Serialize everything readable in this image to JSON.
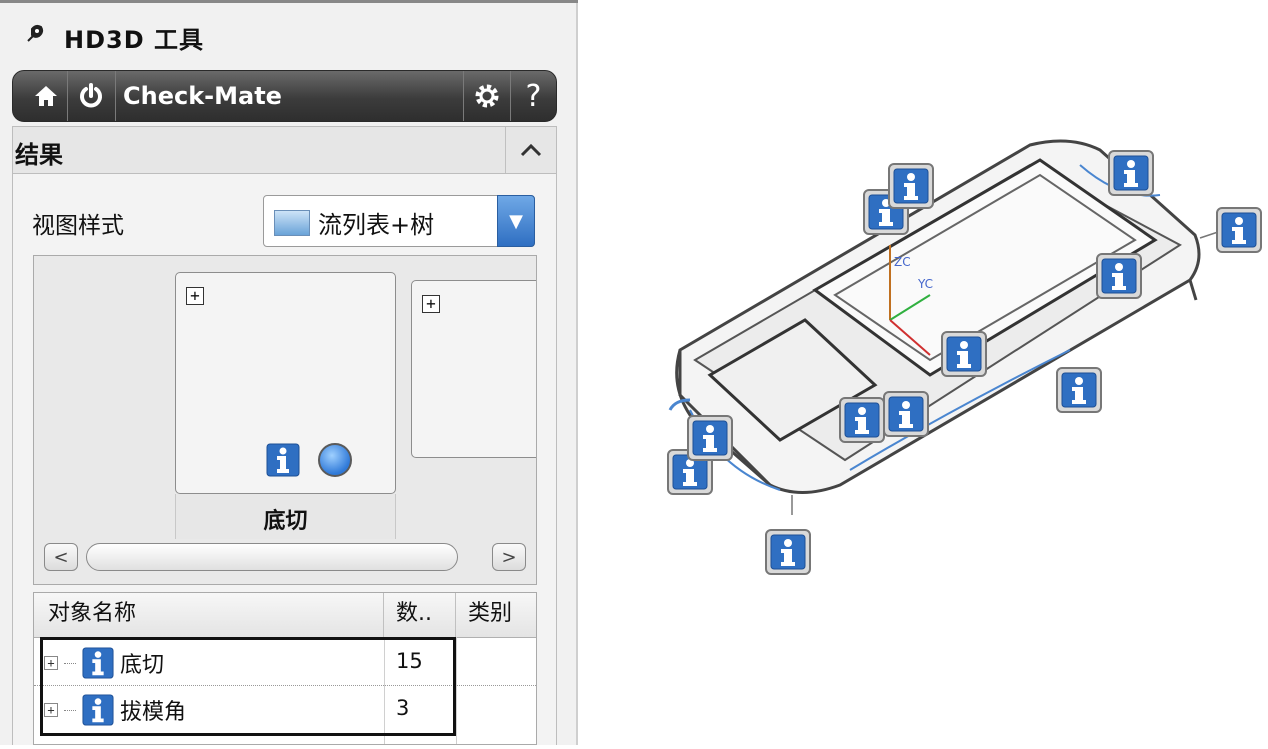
{
  "title": {
    "pin_icon": "pin-icon",
    "text": "HD3D 工具"
  },
  "toolbar": {
    "home_icon": "home-icon",
    "power_icon": "power-icon",
    "label": "Check-Mate",
    "gear_icon": "gear-icon",
    "help_label": "?"
  },
  "section": {
    "title": "结果",
    "collapse_icon": "chevron-up-icon"
  },
  "view_style": {
    "label": "视图样式",
    "selected": "流列表+树"
  },
  "tiles": [
    {
      "label": "底切"
    }
  ],
  "table": {
    "columns": [
      "对象名称",
      "数..",
      "类别"
    ],
    "rows": [
      {
        "name": "底切",
        "count": "15",
        "category": ""
      },
      {
        "name": "拔模角",
        "count": "3",
        "category": ""
      }
    ]
  },
  "colors": {
    "toolbar": "#3c3c3c",
    "info_blue": "#2f6fc2",
    "accent": "#2f79d8"
  }
}
